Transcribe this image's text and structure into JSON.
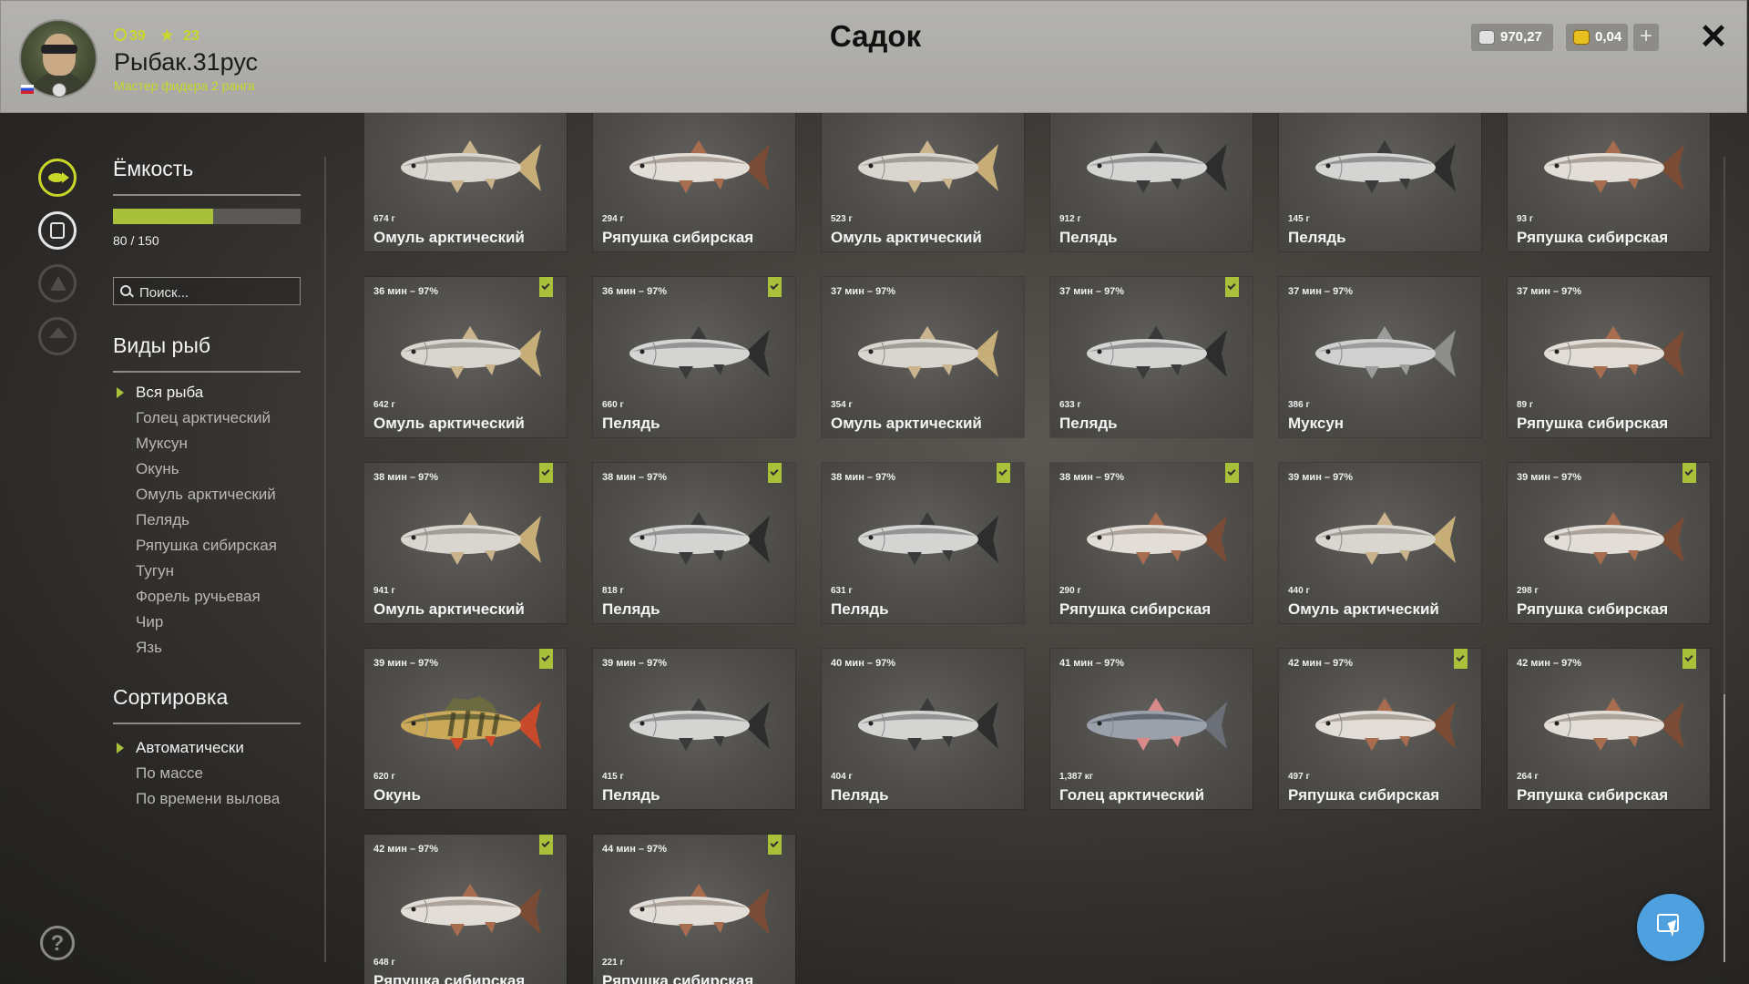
{
  "header": {
    "title": "Садок",
    "player": {
      "name": "Рыбак.31рус",
      "rank": "Мастер фидера 2 ранга",
      "level": "39",
      "stars": "23"
    },
    "currency": {
      "silver": "970,27",
      "gold": "0,04",
      "add_label": "+"
    },
    "close_label": "✕"
  },
  "rail": {
    "items": [
      "fish-icon",
      "keepnet-icon",
      "boat-icon",
      "home-icon"
    ],
    "help_label": "?"
  },
  "capacity": {
    "heading": "Ёмкость",
    "text": "80 / 150",
    "current": 80,
    "max": 150
  },
  "search": {
    "placeholder": "Поиск..."
  },
  "species": {
    "heading": "Виды рыб",
    "items": [
      {
        "label": "Вся рыба",
        "active": true
      },
      {
        "label": "Голец арктический",
        "active": false
      },
      {
        "label": "Муксун",
        "active": false
      },
      {
        "label": "Окунь",
        "active": false
      },
      {
        "label": "Омуль арктический",
        "active": false
      },
      {
        "label": "Пелядь",
        "active": false
      },
      {
        "label": "Ряпушка сибирская",
        "active": false
      },
      {
        "label": "Тугун",
        "active": false
      },
      {
        "label": "Форель ручьевая",
        "active": false
      },
      {
        "label": "Чир",
        "active": false
      },
      {
        "label": "Язь",
        "active": false
      }
    ]
  },
  "sort": {
    "heading": "Сортировка",
    "items": [
      {
        "label": "Автоматически",
        "active": true
      },
      {
        "label": "По массе",
        "active": false
      },
      {
        "label": "По времени вылова",
        "active": false
      }
    ]
  },
  "colors": {
    "accent": "#a9c13a",
    "cursor_button": "#4ea0df"
  },
  "fish": [
    {
      "time": "",
      "weight": "674 г",
      "name": "Омуль арктический",
      "badge": false,
      "kind": "omul"
    },
    {
      "time": "",
      "weight": "294 г",
      "name": "Ряпушка сибирская",
      "badge": false,
      "kind": "ryapushka"
    },
    {
      "time": "",
      "weight": "523 г",
      "name": "Омуль арктический",
      "badge": false,
      "kind": "omul"
    },
    {
      "time": "",
      "weight": "912 г",
      "name": "Пелядь",
      "badge": false,
      "kind": "pelyad"
    },
    {
      "time": "",
      "weight": "145 г",
      "name": "Пелядь",
      "badge": false,
      "kind": "pelyad"
    },
    {
      "time": "",
      "weight": "93 г",
      "name": "Ряпушка сибирская",
      "badge": false,
      "kind": "ryapushka"
    },
    {
      "time": "36 мин – 97%",
      "weight": "642 г",
      "name": "Омуль арктический",
      "badge": true,
      "kind": "omul"
    },
    {
      "time": "36 мин – 97%",
      "weight": "660 г",
      "name": "Пелядь",
      "badge": true,
      "kind": "pelyad"
    },
    {
      "time": "37 мин – 97%",
      "weight": "354 г",
      "name": "Омуль арктический",
      "badge": false,
      "kind": "omul"
    },
    {
      "time": "37 мин – 97%",
      "weight": "633 г",
      "name": "Пелядь",
      "badge": true,
      "kind": "pelyad"
    },
    {
      "time": "37 мин – 97%",
      "weight": "386 г",
      "name": "Муксун",
      "badge": false,
      "kind": "muksun"
    },
    {
      "time": "37 мин – 97%",
      "weight": "89 г",
      "name": "Ряпушка сибирская",
      "badge": false,
      "kind": "ryapushka"
    },
    {
      "time": "38 мин – 97%",
      "weight": "941 г",
      "name": "Омуль арктический",
      "badge": true,
      "kind": "omul"
    },
    {
      "time": "38 мин – 97%",
      "weight": "818 г",
      "name": "Пелядь",
      "badge": true,
      "kind": "pelyad"
    },
    {
      "time": "38 мин – 97%",
      "weight": "631 г",
      "name": "Пелядь",
      "badge": true,
      "kind": "pelyad"
    },
    {
      "time": "38 мин – 97%",
      "weight": "290 г",
      "name": "Ряпушка сибирская",
      "badge": true,
      "kind": "ryapushka"
    },
    {
      "time": "39 мин – 97%",
      "weight": "440 г",
      "name": "Омуль арктический",
      "badge": false,
      "kind": "omul"
    },
    {
      "time": "39 мин – 97%",
      "weight": "298 г",
      "name": "Ряпушка сибирская",
      "badge": true,
      "kind": "ryapushka"
    },
    {
      "time": "39 мин – 97%",
      "weight": "620 г",
      "name": "Окунь",
      "badge": true,
      "kind": "perch"
    },
    {
      "time": "39 мин – 97%",
      "weight": "415 г",
      "name": "Пелядь",
      "badge": false,
      "kind": "pelyad"
    },
    {
      "time": "40 мин – 97%",
      "weight": "404 г",
      "name": "Пелядь",
      "badge": false,
      "kind": "pelyad"
    },
    {
      "time": "41 мин – 97%",
      "weight": "1,387 кг",
      "name": "Голец арктический",
      "badge": false,
      "kind": "char"
    },
    {
      "time": "42 мин – 97%",
      "weight": "497 г",
      "name": "Ряпушка сибирская",
      "badge": true,
      "kind": "ryapushka"
    },
    {
      "time": "42 мин – 97%",
      "weight": "264 г",
      "name": "Ряпушка сибирская",
      "badge": true,
      "kind": "ryapushka"
    },
    {
      "time": "42 мин – 97%",
      "weight": "648 г",
      "name": "Ряпушка сибирская",
      "badge": true,
      "kind": "ryapushka"
    },
    {
      "time": "44 мин – 97%",
      "weight": "221 г",
      "name": "Ряпушка сибирская",
      "badge": true,
      "kind": "ryapushka"
    }
  ]
}
